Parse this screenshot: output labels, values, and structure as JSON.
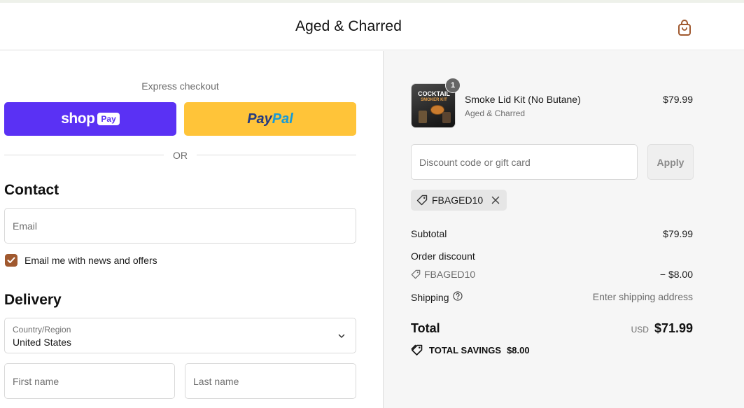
{
  "header": {
    "brand": "Aged & Charred",
    "cart_icon": "shopping-bag-icon",
    "accent_color": "#a0592f"
  },
  "express": {
    "label": "Express checkout",
    "shop_word": "shop",
    "shop_pay_badge": "Pay",
    "paypal_part1": "Pay",
    "paypal_part2": "Pal",
    "or_text": "OR",
    "shop_color": "#5a31f4",
    "paypal_color": "#ffc439"
  },
  "contact": {
    "title": "Contact",
    "email_placeholder": "Email",
    "newsletter_label": "Email me with news and offers",
    "newsletter_checked": true
  },
  "delivery": {
    "title": "Delivery",
    "country_caption": "Country/Region",
    "country_value": "United States",
    "first_name_placeholder": "First name",
    "last_name_placeholder": "Last name"
  },
  "order": {
    "product": {
      "name": "Smoke Lid Kit (No Butane)",
      "vendor": "Aged & Charred",
      "price": "$79.99",
      "quantity": "1",
      "thumb_title": "COCKTAIL",
      "thumb_sub": "SMOKER KIT"
    },
    "discount_placeholder": "Discount code or gift card",
    "apply_label": "Apply",
    "applied_code": "FBAGED10",
    "subtotal_label": "Subtotal",
    "subtotal_value": "$79.99",
    "order_discount_label": "Order discount",
    "discount_code": "FBAGED10",
    "discount_value": "− $8.00",
    "shipping_label": "Shipping",
    "shipping_value": "Enter shipping address",
    "total_label": "Total",
    "total_currency": "USD",
    "total_value": "$71.99",
    "savings_label": "TOTAL SAVINGS",
    "savings_value": "$8.00"
  }
}
